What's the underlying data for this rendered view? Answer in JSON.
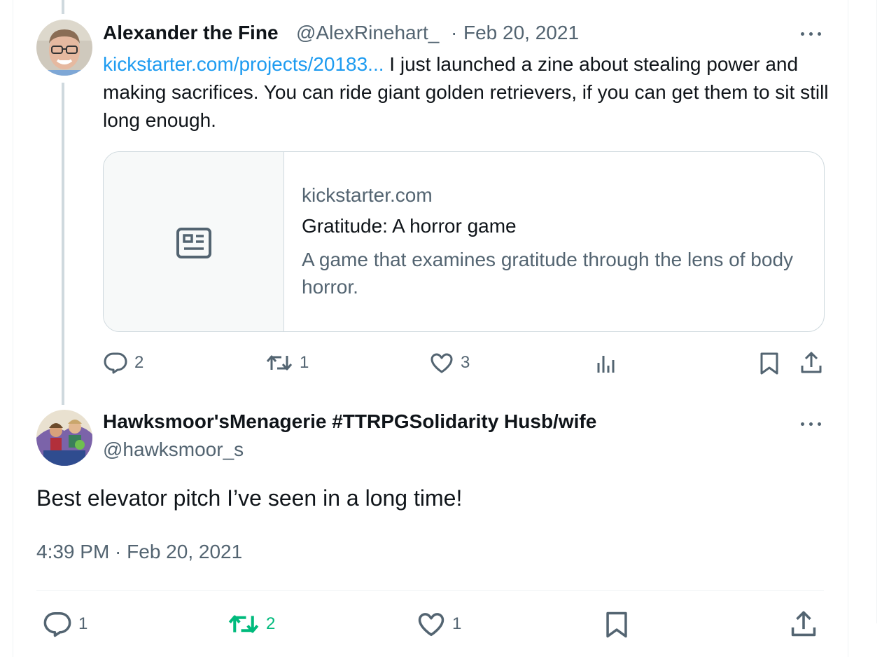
{
  "original_tweet": {
    "author_name": "Alexander the Fine",
    "author_handle": "@AlexRinehart_",
    "separator": "·",
    "date": "Feb 20, 2021",
    "link_text": "kickstarter.com/projects/20183...",
    "body": " I just launched a zine about stealing power and making sacrifices. You can ride giant golden retrievers, if you can get them to sit still long enough.",
    "card": {
      "domain": "kickstarter.com",
      "title": "Gratitude: A horror game",
      "description": "A game that examines gratitude through the lens of body horror.",
      "icon": "article-icon"
    },
    "actions": {
      "replies": "2",
      "retweets": "1",
      "likes": "3"
    }
  },
  "reply_tweet": {
    "author_name": "Hawksmoor'sMenagerie #TTRPGSolidarity Husb/wife",
    "author_handle": "@hawksmoor_s",
    "text": "Best elevator pitch I’ve seen in a long time!",
    "timestamp": "4:39 PM · Feb 20, 2021",
    "actions": {
      "replies": "1",
      "retweets": "2",
      "likes": "1"
    }
  },
  "colors": {
    "link": "#1d9bf0",
    "muted": "#536471",
    "retweet_active": "#00ba7c",
    "border": "#cfd9de"
  }
}
